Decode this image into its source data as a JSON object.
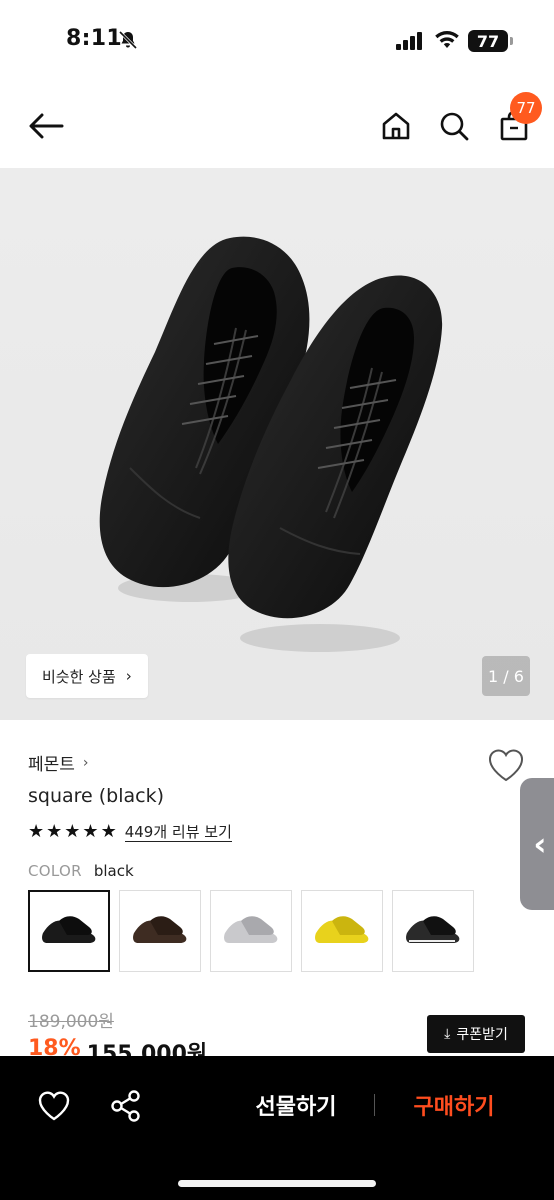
{
  "status_bar": {
    "time": "8:11",
    "battery": "77",
    "icons": [
      "bell-slash-icon",
      "cellular-signal-icon",
      "wifi-icon",
      "battery-icon"
    ]
  },
  "header": {
    "icons": [
      "arrow-left-icon",
      "home-icon",
      "search-icon",
      "shopping-bag-icon"
    ],
    "cart_count": "77"
  },
  "gallery": {
    "similar_label": "비슷한 상품",
    "counter": "1 / 6"
  },
  "product": {
    "brand": "페몬트",
    "name": "square (black)",
    "rating_stars": 5,
    "review_link": "449개 리뷰 보기",
    "color_label": "COLOR",
    "color_value": "black",
    "swatches": [
      {
        "name": "black",
        "color": "#1a1a1a"
      },
      {
        "name": "brown",
        "color": "#3e2c22"
      },
      {
        "name": "silver",
        "color": "#c9c9cc"
      },
      {
        "name": "yellow",
        "color": "#e8d21c"
      },
      {
        "name": "black-white",
        "color": "#2a2a2a"
      }
    ],
    "selected_swatch": 0,
    "original_price": "189,000원",
    "discount": "18%",
    "sale_price": "155,000원",
    "coupon_label": "쿠폰받기"
  },
  "bottom_bar": {
    "gift_label": "선물하기",
    "buy_label": "구매하기"
  },
  "colors": {
    "accent": "#ff5a1f",
    "buy": "#ff4d1f",
    "bottom_bar": "#000000"
  }
}
